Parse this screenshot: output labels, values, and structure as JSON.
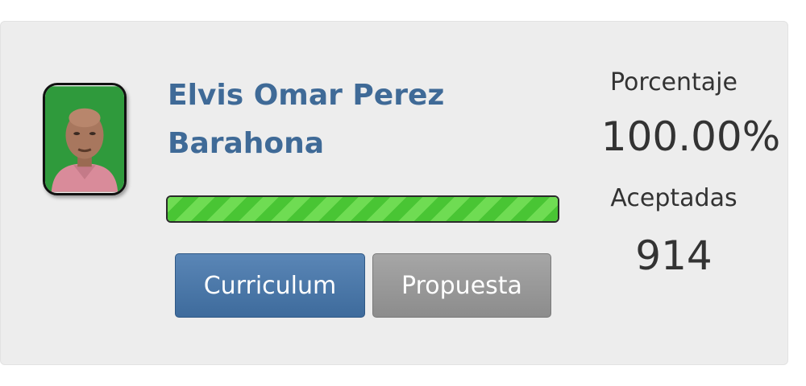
{
  "candidate": {
    "name_line1": "Elvis Omar Perez",
    "name_line2": "Barahona",
    "avatar_icon": "candidate-photo",
    "progress_percent": 100
  },
  "actions": {
    "curriculum_label": "Curriculum",
    "propuesta_label": "Propuesta"
  },
  "stats": {
    "percentage_label": "Porcentaje",
    "percentage_value": "100.00%",
    "accepted_label": "Aceptadas",
    "accepted_value": "914"
  },
  "colors": {
    "name": "#3f6a97",
    "curriculum_button": "#4a76a8",
    "propuesta_button": "#999999",
    "progress": "#5bd043"
  }
}
